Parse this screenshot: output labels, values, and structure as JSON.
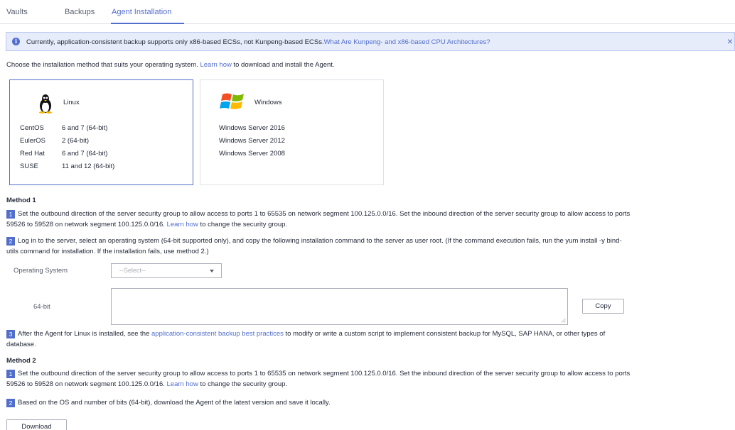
{
  "tabs": [
    {
      "label": "Vaults"
    },
    {
      "label": "Backups"
    },
    {
      "label": "Agent Installation"
    }
  ],
  "active_tab": "Agent Installation",
  "notice": {
    "text": "Currently, application-consistent backup supports only x86-based ECSs, not Kunpeng-based ECSs.",
    "link": "What Are Kunpeng- and x86-based CPU Architectures?",
    "close": "×"
  },
  "intro": {
    "before": "Choose the installation method that suits your operating system. ",
    "link": "Learn how",
    "after": " to download and install the Agent."
  },
  "cards": {
    "linux": {
      "title": "Linux",
      "rows": [
        {
          "name": "CentOS",
          "version": "6 and 7 (64-bit)"
        },
        {
          "name": "EulerOS",
          "version": "2 (64-bit)"
        },
        {
          "name": "Red Hat",
          "version": "6 and 7 (64-bit)"
        },
        {
          "name": "SUSE",
          "version": "11 and 12 (64-bit)"
        }
      ]
    },
    "windows": {
      "title": "Windows",
      "rows": [
        "Windows Server 2016",
        "Windows Server 2012",
        "Windows Server 2008"
      ]
    }
  },
  "method1": {
    "title": "Method 1",
    "step1": {
      "num": "1",
      "line1": "Set the outbound direction of the server security group to allow access to ports 1 to 65535 on network segment 100.125.0.0/16. Set the inbound direction of the server security group to allow access to ports",
      "line2_before": "59526 to 59528 on network segment 100.125.0.0/16. ",
      "link": "Learn how",
      "line2_after": " to change the security group."
    },
    "step2": {
      "num": "2",
      "line1": "Log in to the server, select an operating system (64-bit supported only), and copy the following installation command to the server as user root. (If the command execution fails, run the yum install -y bind-",
      "line2": "utils command for installation. If the installation fails, use method 2.)"
    },
    "os_label": "Operating System",
    "os_placeholder": "--Select--",
    "bit_label": "64-bit",
    "command_value": "",
    "copy_button": "Copy",
    "step3": {
      "num": "3",
      "before": "After the Agent for Linux is installed, see the ",
      "link": "application-consistent backup best practices",
      "after": " to modify or write a custom script to implement consistent backup for MySQL, SAP HANA, or other types of",
      "line2": "database."
    }
  },
  "method2": {
    "title": "Method 2",
    "step1": {
      "num": "1",
      "line1": "Set the outbound direction of the server security group to allow access to ports 1 to 65535 on network segment 100.125.0.0/16. Set the inbound direction of the server security group to allow access to ports",
      "line2_before": "59526 to 59528 on network segment 100.125.0.0/16. ",
      "link": "Learn how",
      "line2_after": " to change the security group."
    },
    "step2": {
      "num": "2",
      "text": "Based on the OS and number of bits (64-bit), download the Agent of the latest version and save it locally."
    },
    "download_button": "Download"
  },
  "icons": {
    "info": "info-circle-icon",
    "close": "close-icon",
    "linux": "linux-tux-icon",
    "windows": "windows-logo-icon",
    "dropdown": "chevron-down-icon"
  },
  "colors": {
    "accent": "#526ecc",
    "notice_bg": "#e6ecfa",
    "text": "#252b3a"
  }
}
